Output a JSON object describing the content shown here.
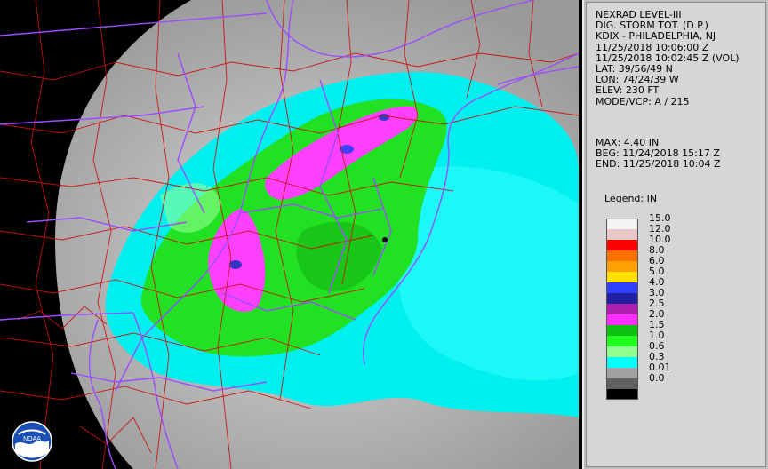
{
  "info": {
    "lines_top": [
      "NEXRAD LEVEL-III",
      "DIG. STORM TOT. (D.P.)",
      "KDIX - PHILADELPHIA, NJ",
      "11/25/2018 10:06:00 Z",
      "11/25/2018 10:02:45 Z (VOL)",
      "LAT: 39/56/49 N",
      "LON: 74/24/39 W",
      "ELEV: 230 FT",
      "MODE/VCP: A / 215"
    ],
    "lines_bottom": [
      "MAX: 4.40 IN",
      "BEG: 11/24/2018 15:17 Z",
      "END: 11/25/2018 10:04 Z"
    ]
  },
  "legend": {
    "title": "Legend: IN",
    "labels": [
      "15.0",
      "12.0",
      "10.0",
      "8.0",
      "6.0",
      "5.0",
      "4.0",
      "3.0",
      "2.5",
      "2.0",
      "1.5",
      "1.0",
      "0.6",
      "0.3",
      "0.01",
      "0.0"
    ],
    "colors": [
      "#f4f4f4",
      "#e8c8c8",
      "#ff0000",
      "#ff7000",
      "#ffa000",
      "#ffe000",
      "#3040ff",
      "#2020a0",
      "#b020b0",
      "#ff30ff",
      "#10c010",
      "#20ff20",
      "#90ff90",
      "#00ffff",
      "#a0a0a0",
      "#606060",
      "#000000"
    ]
  },
  "map": {
    "logo_text": "NOAA",
    "colors": {
      "state_lines": "#9a4cff",
      "county_lines": "#cc1010",
      "background": "#000000"
    }
  }
}
